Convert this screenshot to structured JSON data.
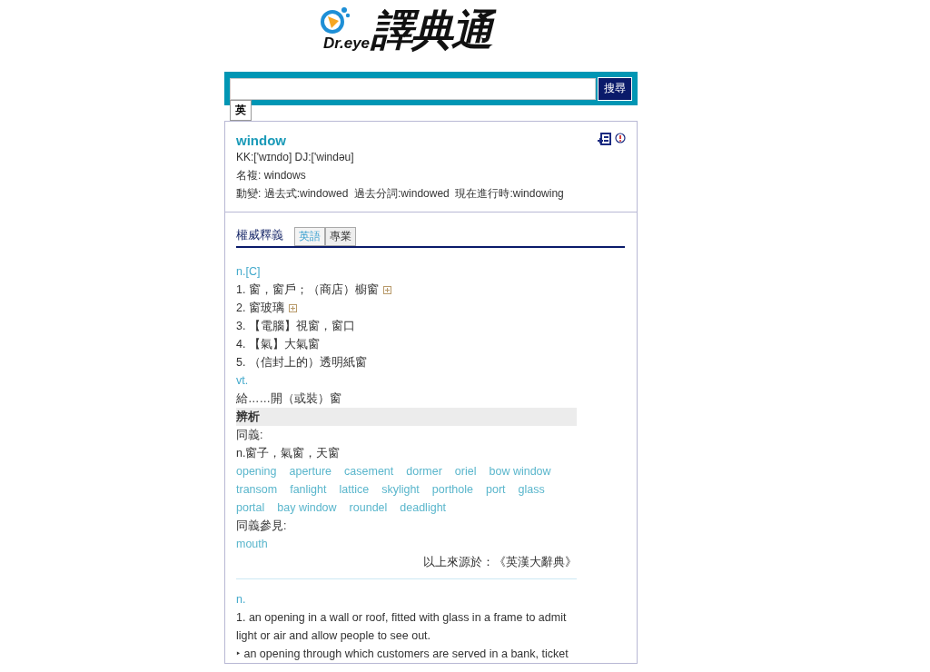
{
  "logo": {
    "brand": "Dr.eye",
    "name": "譯典通"
  },
  "search": {
    "button": "搜尋"
  },
  "language_tab": "英",
  "entry": {
    "word": "window",
    "pronunciation": "KK:['wɪndo] DJ:['windəu]",
    "plural": "名複: windows",
    "inflection": "動變: 過去式:windowed  過去分詞:windowed  現在進行時:windowing"
  },
  "section": {
    "title": "權威釋義",
    "tabs": [
      {
        "label": "英語",
        "selected": true
      },
      {
        "label": "專業",
        "selected": false
      }
    ]
  },
  "dictionary_1": [
    {
      "kind": "pos",
      "text": "n.[C]"
    },
    {
      "kind": "sense",
      "text": "1. 窗，窗戶；（商店）櫥窗",
      "expand": true
    },
    {
      "kind": "sense",
      "text": "2. 窗玻璃",
      "expand": true
    },
    {
      "kind": "sense",
      "text": "3. 【電腦】視窗，窗口",
      "expand": false
    },
    {
      "kind": "sense",
      "text": "4. 【氣】大氣窗",
      "expand": false
    },
    {
      "kind": "sense",
      "text": "5. （信封上的）透明紙窗",
      "expand": false
    },
    {
      "kind": "pos",
      "text": "vt."
    },
    {
      "kind": "sense",
      "text": "給……開（或裝）窗",
      "expand": false
    },
    {
      "kind": "heading",
      "text": "辨析"
    },
    {
      "kind": "text",
      "text": "同義:"
    },
    {
      "kind": "text",
      "text": "n.窗子，氣窗，天窗"
    },
    {
      "kind": "links",
      "links": [
        "opening",
        "aperture",
        "casement",
        "dormer",
        "oriel",
        "bow window",
        "transom",
        "fanlight",
        "lattice",
        "skylight",
        "porthole",
        "port",
        "glass",
        "portal",
        "bay window",
        "roundel",
        "deadlight"
      ]
    },
    {
      "kind": "text",
      "text": "同義參見:"
    },
    {
      "kind": "links",
      "links": [
        "mouth"
      ]
    }
  ],
  "source": "以上來源於：《英漢大辭典》",
  "dictionary_2": [
    {
      "kind": "pos",
      "text": "n."
    },
    {
      "kind": "text",
      "text": "1. an opening in a wall or roof, fitted with glass in a frame to admit light or air and allow people to see out."
    },
    {
      "kind": "text",
      "text": "‣ an opening through which customers are served in a bank, ticket"
    }
  ]
}
